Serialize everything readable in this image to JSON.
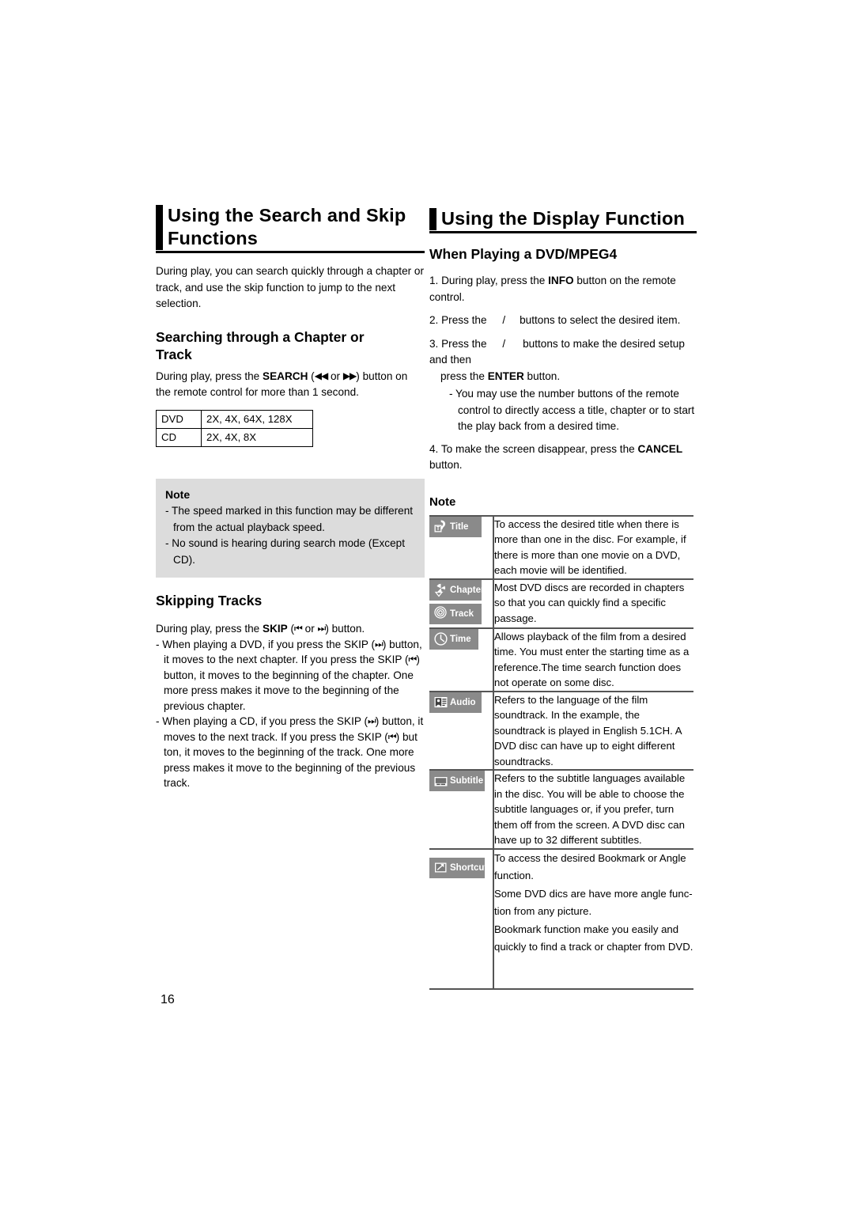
{
  "page": {
    "number": "16"
  },
  "left_column": {
    "heading_line1": "Using the Search and Skip",
    "heading_line2": "Functions",
    "intro": "During play, you can search quickly through a chapter or track, and use the skip function to jump to the next selection.",
    "subheading_search_line1": "Searching through a Chapter or",
    "subheading_search_line2": "Track",
    "search_text_pre": "During play, press the ",
    "search_text_bold": "SEARCH",
    "search_text_open": " (",
    "search_glyph_rew": "◀◀",
    "search_text_or": " or ",
    "search_glyph_ff": "▶▶",
    "search_text_post": ") button on the remote control for more than 1 second.",
    "speed_table": {
      "rows": [
        {
          "label": "DVD",
          "speeds": "2X, 4X, 64X, 128X"
        },
        {
          "label": "CD",
          "speeds": "2X, 4X, 8X"
        }
      ]
    },
    "note": {
      "title": "Note",
      "items": [
        "- The speed marked in this function may be different from the actual playback speed.",
        "- No sound is hearing during search mode (Except CD)."
      ]
    },
    "subheading_skipping": "Skipping Tracks",
    "skip_intro_pre": "During play, press the ",
    "skip_intro_bold": "SKIP",
    "skip_intro_open": " (",
    "skip_glyph_prev": "⏮",
    "skip_intro_or": " or ",
    "skip_glyph_next": "⏭",
    "skip_intro_post": ") button.",
    "skip_bullet_dvd_1": "- When playing a DVD, if you press the SKIP (",
    "skip_bullet_dvd_2": ") button, it moves to the next chapter. If you press the SKIP (",
    "skip_bullet_dvd_3": ") button, it moves to the beginning of the chapter. One more press makes it move to the beginning of the previous chapter.",
    "skip_bullet_cd_1": "- When playing a CD, if you press the SKIP (",
    "skip_bullet_cd_2": ") button, it moves to   the next track. If you press the SKIP (",
    "skip_bullet_cd_3": ") but ton, it moves   to the beginning of the track. One more press makes it   move to the beginning of the previous track."
  },
  "right_column": {
    "heading": "Using the Display Function",
    "subheading": "When Playing a DVD/MPEG4",
    "steps": [
      "1. During play, press the INFO button on the remote control.",
      "2. Press the     /     buttons to select the desired item.",
      "3. Press the     /     buttons to make the desired setup and then press the ENTER button.",
      "- You may use the number buttons of the remote control to directly access a title, chapter or to start the play back from a desired time.",
      "4. To make the screen disappear, press the CANCEL button."
    ],
    "step1_pre": "1. During play, press the ",
    "step1_bold": "INFO",
    "step1_post": " button on the remote control.",
    "step2_pre": "2. Press the ",
    "step2_mid": "/",
    "step2_post": "buttons to select the desired item.",
    "step3_pre": "3. Press the ",
    "step3_mid": "/",
    "step3_post": "buttons to make the desired setup and then",
    "step3_line2_pre": "press the ",
    "step3_line2_bold": "ENTER",
    "step3_line2_post": " button.",
    "step3_sub": "- You may use the number buttons of the remote control to directly access a title, chapter or to start the play back from a desired time.",
    "step4_pre": "4. To make the screen disappear, press the ",
    "step4_bold": "CANCEL",
    "step4_post": " button.",
    "note_heading": "Note",
    "legend": [
      {
        "icons": [
          {
            "name": "title-icon",
            "label": "Title"
          }
        ],
        "description": "To access the desired title when there is more than one in the disc. For example, if there is more than one movie on a DVD, each movie will be identified."
      },
      {
        "icons": [
          {
            "name": "chapter-icon",
            "label": "Chapter"
          },
          {
            "name": "track-icon",
            "label": "Track"
          }
        ],
        "description": "Most DVD discs are recorded in chapters so that you can quickly find a specific passage."
      },
      {
        "icons": [
          {
            "name": "time-icon",
            "label": "Time"
          }
        ],
        "description": "Allows playback of the film from a desired time. You must enter the starting time as a reference.The time search function does not operate on some disc."
      },
      {
        "icons": [
          {
            "name": "audio-icon",
            "label": "Audio"
          }
        ],
        "description": "Refers to the language of the film soundtrack. In the example, the soundtrack is played in English 5.1CH. A DVD disc can have up to eight different soundtracks."
      },
      {
        "icons": [
          {
            "name": "subtitle-icon",
            "label": "Subtitle"
          }
        ],
        "description": "Refers to the subtitle languages available in the disc. You will be able to choose the subtitle languages or, if you prefer, turn them off from the screen. A DVD disc can have up to 32 different subtitles."
      },
      {
        "icons": [
          {
            "name": "shortcut-icon",
            "label": "Shortcut"
          }
        ],
        "description": "To access the desired Bookmark or Angle function.\nSome DVD dics are have more angle func-\ntion from any picture.\nBookmark function make you easily and\nquickly to find a track or chapter from DVD."
      }
    ]
  },
  "colors": {
    "note_box_bg": "#dcdcdc",
    "icon_pill_bg": "#8a8a8a",
    "rule": "#000000",
    "table_rule": "#555555"
  }
}
